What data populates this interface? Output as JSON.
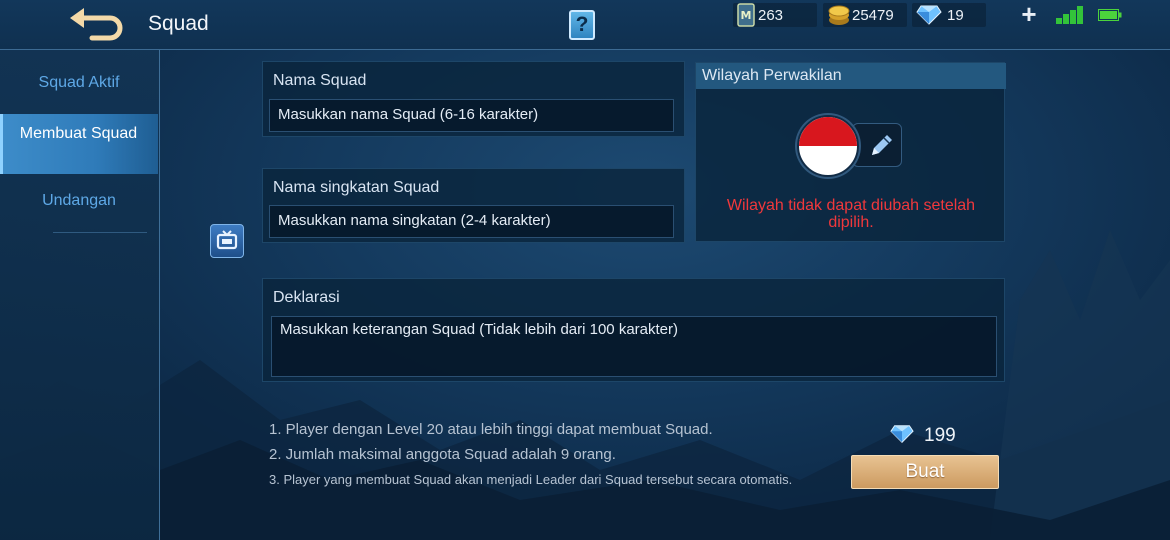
{
  "header": {
    "title": "Squad",
    "back_icon": "back-arrow-icon",
    "help_icon": "help-icon",
    "help_label": "?",
    "resources": [
      {
        "name": "ticket",
        "icon": "ticket-icon",
        "value": "263"
      },
      {
        "name": "battle-points",
        "icon": "coin-icon",
        "value": "25479"
      },
      {
        "name": "diamonds",
        "icon": "diamond-icon",
        "value": "19"
      }
    ],
    "plus_label": "+",
    "signal_icon": "signal-icon",
    "battery_icon": "battery-icon"
  },
  "sidebar": {
    "items": [
      {
        "label": "Squad Aktif",
        "active": false
      },
      {
        "label": "Membuat Squad",
        "active": true
      },
      {
        "label": "Undangan",
        "active": false
      }
    ]
  },
  "form": {
    "name": {
      "label": "Nama Squad",
      "placeholder": "Masukkan nama Squad (6-16 karakter)"
    },
    "short": {
      "label": "Nama singkatan Squad",
      "placeholder": "Masukkan nama singkatan (2-4 karakter)"
    },
    "declaration": {
      "label": "Deklarasi",
      "placeholder": "Masukkan keterangan Squad (Tidak lebih dari 100 karakter)"
    }
  },
  "region": {
    "title": "Wilayah Perwakilan",
    "flag_icon": "indonesia-flag-icon",
    "edit_icon": "pencil-icon",
    "warning": "Wilayah tidak dapat diubah setelah dipilih."
  },
  "rules": [
    "1. Player dengan Level 20 atau lebih tinggi dapat membuat Squad.",
    "2. Jumlah maksimal anggota Squad adalah 9 orang.",
    "3. Player yang membuat Squad akan menjadi Leader dari Squad tersebut secara otomatis."
  ],
  "create": {
    "cost": "199",
    "cost_icon": "diamond-icon",
    "button_label": "Buat"
  },
  "colors": {
    "accent": "#2f7bb9",
    "warning": "#f0383c",
    "button": "#d8a86c"
  }
}
